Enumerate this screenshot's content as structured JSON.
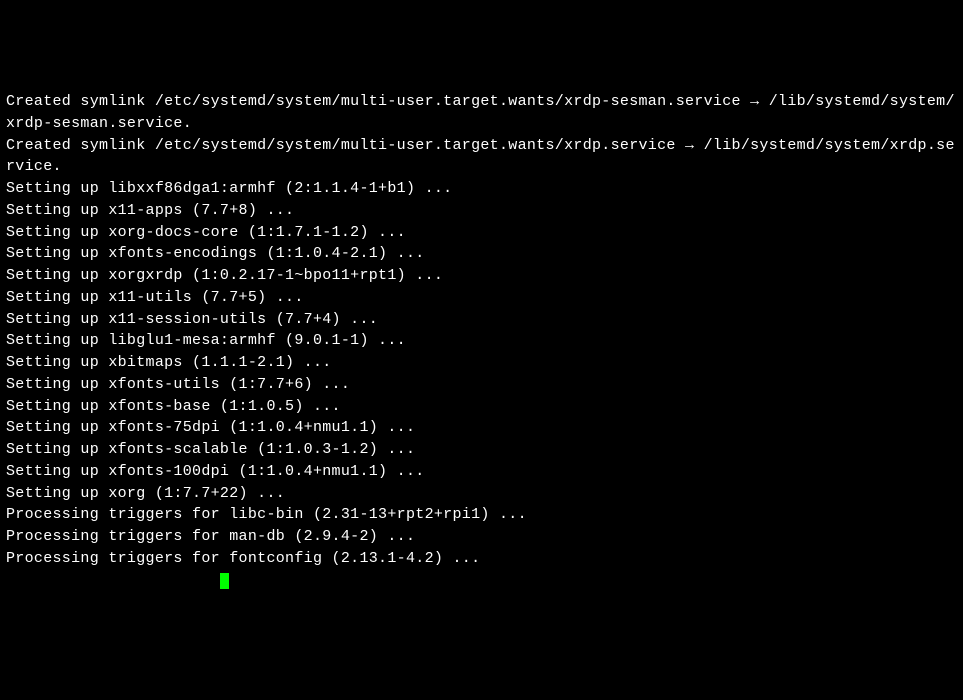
{
  "terminal": {
    "lines": [
      "Created symlink /etc/systemd/system/multi-user.target.wants/xrdp-sesman.service → /lib/systemd/system/xrdp-sesman.service.",
      "Created symlink /etc/systemd/system/multi-user.target.wants/xrdp.service → /lib/systemd/system/xrdp.service.",
      "Setting up libxxf86dga1:armhf (2:1.1.4-1+b1) ...",
      "Setting up x11-apps (7.7+8) ...",
      "Setting up xorg-docs-core (1:1.7.1-1.2) ...",
      "Setting up xfonts-encodings (1:1.0.4-2.1) ...",
      "Setting up xorgxrdp (1:0.2.17-1~bpo11+rpt1) ...",
      "Setting up x11-utils (7.7+5) ...",
      "Setting up x11-session-utils (7.7+4) ...",
      "Setting up libglu1-mesa:armhf (9.0.1-1) ...",
      "Setting up xbitmaps (1.1.1-2.1) ...",
      "Setting up xfonts-utils (1:7.7+6) ...",
      "Setting up xfonts-base (1:1.0.5) ...",
      "Setting up xfonts-75dpi (1:1.0.4+nmu1.1) ...",
      "Setting up xfonts-scalable (1:1.0.3-1.2) ...",
      "Setting up xfonts-100dpi (1:1.0.4+nmu1.1) ...",
      "Setting up xorg (1:7.7+22) ...",
      "Processing triggers for libc-bin (2.31-13+rpt2+rpi1) ...",
      "Processing triggers for man-db (2.9.4-2) ...",
      "Processing triggers for fontconfig (2.13.1-4.2) ..."
    ],
    "prompt_prefix": "                       "
  }
}
